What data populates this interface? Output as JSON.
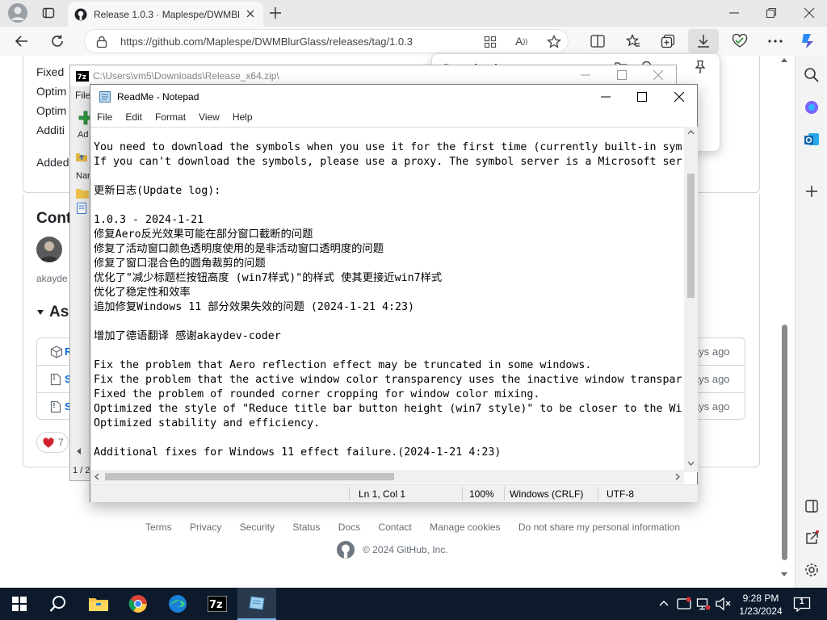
{
  "browser": {
    "tab_title": "Release 1.0.3 · Maplespe/DWMBlurGlass",
    "url": "https://github.com/Maplespe/DWMBlurGlass/releases/tag/1.0.3"
  },
  "page_left": {
    "lines": [
      "Fixed",
      "Optim",
      "Optim",
      "Additi",
      "Added"
    ],
    "contributors_heading": "Cont",
    "contributor_name": "akayde",
    "assets_heading": "Ass",
    "asset_rows": [
      "R",
      "S",
      "S"
    ],
    "asset_times": [
      "ays ago",
      "ays ago",
      "ays ago"
    ],
    "reaction_count": "7"
  },
  "downloads": {
    "heading": "Downloads"
  },
  "sevenzip": {
    "path": "C:\\Users\\vm5\\Downloads\\Release_x64.zip\\",
    "menu_first": "File",
    "add_label": "Ad",
    "name_col": "Nar",
    "status": "1 / 2"
  },
  "notepad": {
    "title": "ReadMe - Notepad",
    "menu": [
      "File",
      "Edit",
      "Format",
      "View",
      "Help"
    ],
    "content": "You need to download the symbols when you use it for the first time (currently built-in sym\nIf you can't download the symbols, please use a proxy. The symbol server is a Microsoft ser\n\n更新日志(Update log):\n\n1.0.3 - 2024-1-21\n修复Aero反光效果可能在部分窗口截断的问题\n修复了活动窗口颜色透明度使用的是非活动窗口透明度的问题\n修复了窗口混合色的圆角裁剪的问题\n优化了\"减少标题栏按钮高度 (win7样式)\"的样式 使其更接近win7样式\n优化了稳定性和效率\n追加修复Windows 11 部分效果失效的问题 (2024-1-21 4:23)\n\n增加了德语翻译 感谢akaydev-coder\n\nFix the problem that Aero reflection effect may be truncated in some windows.\nFix the problem that the active window color transparency uses the inactive window transpar\nFixed the problem of rounded corner cropping for window color mixing.\nOptimized the style of \"Reduce title bar button height (win7 style)\" to be closer to the Wi\nOptimized stability and efficiency.\n\nAdditional fixes for Windows 11 effect failure.(2024-1-21 4:23)",
    "status": {
      "position": "Ln 1, Col 1",
      "zoom": "100%",
      "eol": "Windows (CRLF)",
      "encoding": "UTF-8"
    }
  },
  "footer": {
    "links": [
      "Terms",
      "Privacy",
      "Security",
      "Status",
      "Docs",
      "Contact",
      "Manage cookies",
      "Do not share my personal information"
    ],
    "copyright": "© 2024 GitHub, Inc."
  },
  "taskbar": {
    "time": "9:28 PM",
    "date": "1/23/2024",
    "notifications": "1"
  },
  "colors": {
    "taskbar": "#0c1a2c",
    "accent": "#0078d4"
  }
}
